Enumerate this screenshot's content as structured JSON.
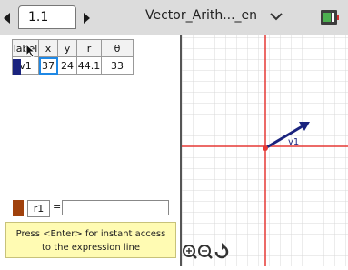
{
  "titlebar": {
    "tab_label": "1.1",
    "document_title": "Vector_Arith..._en"
  },
  "lists": {
    "columns": [
      "label",
      "x",
      "y",
      "r",
      "θ"
    ],
    "rows": [
      [
        "v1",
        "37",
        "24",
        "44.1",
        "33"
      ]
    ]
  },
  "variable": {
    "name": "r1",
    "equals": "=",
    "value": ""
  },
  "hint": {
    "line1": "Press <Enter> for instant access",
    "line2": "to the expression line"
  },
  "graph": {
    "vector_label": "v1",
    "axis_color": "#e53935",
    "vector_color": "#1a237e",
    "origin_color": "#e53935"
  },
  "colors": {
    "row_marker": "#1a237e",
    "variable_swatch": "#a0410c",
    "hint_background": "#fffbb3"
  }
}
